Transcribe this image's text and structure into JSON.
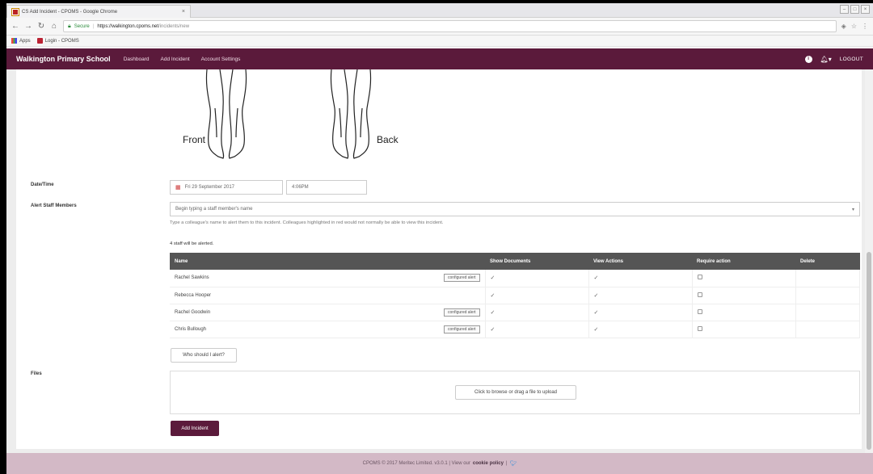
{
  "browser": {
    "tab_title": "CS Add Incident - CPOMS - Google Chrome",
    "tab_close": "×",
    "win_min": "–",
    "win_max": "□",
    "win_close": "×",
    "secure_label": "Secure",
    "url_host": "https://walkington.cpoms.net",
    "url_path": "/incidents/new",
    "bookmarks": [
      {
        "label": "Apps"
      },
      {
        "label": "Login - CPOMS"
      }
    ]
  },
  "navbar": {
    "brand": "Walkington Primary School",
    "links": [
      "Dashboard",
      "Add Incident",
      "Account Settings"
    ],
    "logout": "LOGOUT"
  },
  "diagram": {
    "front_label": "Front",
    "back_label": "Back"
  },
  "form": {
    "datetime_label": "Date/Time",
    "date_value": "Fri 29 September 2017",
    "time_value": "4:06PM",
    "alert_label": "Alert Staff Members",
    "staff_placeholder": "Begin typing a staff member's name",
    "help_text": "Type a colleague's name to alert them to this incident. Colleagues highlighted in red would not normally be able to view this incident.",
    "staff_count_text": "4 staff will be alerted.",
    "table_headers": [
      "Name",
      "Show Documents",
      "View Actions",
      "Require action",
      "Delete"
    ],
    "badge_text": "configured alert",
    "staff_rows": [
      {
        "name": "Rachel Sawkins"
      },
      {
        "name": "Rebecca Hooper"
      },
      {
        "name": "Rachel Goodwin"
      },
      {
        "name": "Chris Bullough"
      }
    ],
    "who_alert_button": "Who should I alert?",
    "files_label": "Files",
    "upload_button": "Click to browse or drag a file to upload",
    "submit_button": "Add Incident"
  },
  "footer": {
    "text": "CPOMS © 2017 Meritec Limited. v3.0.1 | View our",
    "link": "cookie policy",
    "after": "|"
  },
  "colors": {
    "brand": "#5b1a3b",
    "footer": "#d3b9c6",
    "table_header": "#555555"
  }
}
